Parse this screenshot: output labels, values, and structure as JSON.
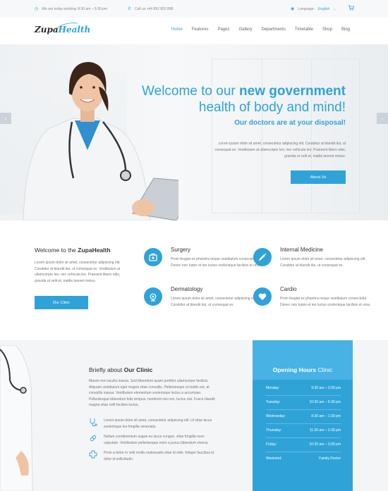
{
  "topbar": {
    "working_hours": "We are today working: 8:30 am – 5:30 pm",
    "phone": "Call us +44 852 852 888",
    "language_label": "Language:",
    "language_value": "English"
  },
  "brand": {
    "name_part1": "Zupa",
    "name_part2": "Health"
  },
  "nav": {
    "items": [
      "Home",
      "Features",
      "Pages",
      "Gallery",
      "Departments",
      "Timetable",
      "Shop",
      "Blog"
    ]
  },
  "hero": {
    "title_line1_a": "Welcome to our ",
    "title_line1_b": "new government",
    "title_line2": "health of body and mind!",
    "subtitle": "Our doctors are at your disposal!",
    "text": "Lorem ipsum dolor sit amet, consectetur adipiscing elit. Curabitur at blandit dui, ut consequat ex. Vestibulum at ullamcorper leo, nec vehicula leo. Praesent libero odio, gravida ut velit et, mattis laoreet metus.",
    "button": "About Us"
  },
  "welcome": {
    "title_a": "Welcome to the ",
    "title_b": "ZupaHealth",
    "text": "Lorem ipsum dolor sit amet, consectetur adipiscing elit. Curabitur at blandit dui, ut consequat ex. Vestibulum at ullamcorper leo, nec vehicula leo. Praesent libero odio, gravida ut velit et, mattis laoreet metus.",
    "button": "Our Clinic"
  },
  "services": [
    {
      "name": "Surgery",
      "desc": "Proin feugiat ex pharetra neque vestibulum consectetur. Donec non turpis et leo luctus scelerisque facilisis et urna."
    },
    {
      "name": "Internal Medicine",
      "desc": "Lorem ipsum dolor sit amet, consectetur adipiscing elit. Curabitur at blandit dui, ut consequat ex."
    },
    {
      "name": "Dermatology",
      "desc": "Lorem ipsum dolor sit amet, consectetur adipiscing elit. Curabitur at blandit dui, ut consequat ex."
    },
    {
      "name": "Cardio",
      "desc": "Proin feugiat ex pharetra neque vestibulum consectetur. Donec non turpis et leo luctus scelerisque facilisis et urna."
    }
  ],
  "about": {
    "title_a": "Briefly about ",
    "title_b": "Our Clinic",
    "text": "Mauris non iaculis massa. Sed bibendum quam porttitor ullamcorper facilisis. Aliquam vestibulum eget magna vitae convallis. Pellentesque ut mattis est, at convallis massa. Vestibulum elementum scelerisque lectus a accumsan. Pellentesque bibendum felis tempus, hendrerit nisi non, luctus nisi. Fusce blandit magna vitae velit facilisis luctus.",
    "features": [
      "Lorem ipsum dolor sit amet, consectetur adipiscing elit. Ut vitae lacus scelerisque leo fringilla venenatis.",
      "Nullam condimentum augue eu lacus congue, vitae fringilla nunc vulputate. Vestibulum pellentesque enim a purus bibendum viverra.",
      "Proin a tortor in velit mollis malesuada vitae id odio. Integer faucibus id dolor id sollicitudin."
    ]
  },
  "hours": {
    "title_a": "Opening Hours ",
    "title_b": "Clinic",
    "rows": [
      {
        "day": "Monday:",
        "time": "9:30 am – 3:30 pm"
      },
      {
        "day": "Tuesday:",
        "time": "10:30 am – 5:30 pm"
      },
      {
        "day": "Wednesday:",
        "time": "8:30 am – 1:30 pm"
      },
      {
        "day": "Thursday:",
        "time": "11:30 am – 2:30 pm"
      },
      {
        "day": "Friday:",
        "time": "10:30 am – 3:30 pm"
      },
      {
        "day": "Weekend:",
        "time": "Family Doctor"
      }
    ]
  },
  "colors": {
    "accent": "#2fa3d8",
    "accent_light": "#47b2e3",
    "text_dark": "#333333",
    "text_muted": "#777777",
    "bg_light": "#f4f5f6"
  }
}
